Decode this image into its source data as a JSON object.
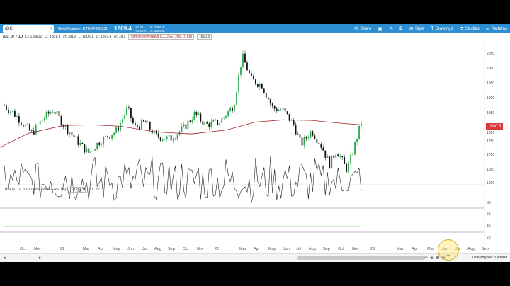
{
  "header": {
    "symbol": "/GC",
    "description": "Gold Futures, ETH (FEB 23)",
    "last": "1809.4",
    "change": "+7.90",
    "change_pct": "+0.44%",
    "bid": "B: 1806.4",
    "ask": "A: 1809.8",
    "buttons": [
      {
        "icon": "share-icon",
        "label": "Share"
      },
      {
        "icon": "clipboard-icon",
        "label": ""
      },
      {
        "icon": "gear-icon",
        "label": ""
      },
      {
        "icon": "period-icon",
        "label": "D"
      },
      {
        "icon": "style-icon",
        "label": "Style"
      },
      {
        "icon": "drawings-icon",
        "label": "Drawings"
      },
      {
        "icon": "studies-icon",
        "label": "Studies"
      },
      {
        "icon": "patterns-icon",
        "label": "Patterns"
      }
    ]
  },
  "legend": {
    "symbol": "/GC 10 Y 1D",
    "date": "D: 12/9/22",
    "open": "O: 1801.9",
    "high": "H: 1819",
    "low": "L: 1800.1",
    "close": "C: 1809.4",
    "range": "R: 18.9",
    "sma": "SimpleMovingAvg (CLOSE, 200, 0, no)",
    "sma_value": "1800.5"
  },
  "rsi_legend": {
    "study": "RSI (5, 70, 30, CLOSE, WILDERS, no)",
    "value": "70.2543",
    "overbought": "30",
    "oversold": "70"
  },
  "price_axis": [
    "2050",
    "2000",
    "1950",
    "1900",
    "1850",
    "1800",
    "1750",
    "1700",
    "1650",
    "1600"
  ],
  "price_tag": "1800.5",
  "rsi_axis": [
    "80",
    "60",
    "40",
    "20"
  ],
  "x_axis": [
    "Oct",
    "Nov",
    "21",
    "Mar",
    "Apr",
    "May",
    "Jun",
    "Jul",
    "Aug",
    "Sep",
    "Oct",
    "Nov",
    "22",
    "Mar",
    "Apr",
    "May",
    "Jun",
    "Jul",
    "Aug",
    "Sep",
    "Oct",
    "Nov",
    "23",
    "Mar",
    "Apr",
    "May",
    "Jun",
    "Jul",
    "Aug",
    "Sep"
  ],
  "footer": {
    "drawing_set": "Drawing set: Default"
  },
  "colors": {
    "toolbar": "#2c8fd3",
    "up_candle": "#2aa84a",
    "down_candle": "#111111",
    "sma": "#a0282a",
    "rsi_line": "#222222",
    "rsi_bands": "#8e5aa8"
  }
}
